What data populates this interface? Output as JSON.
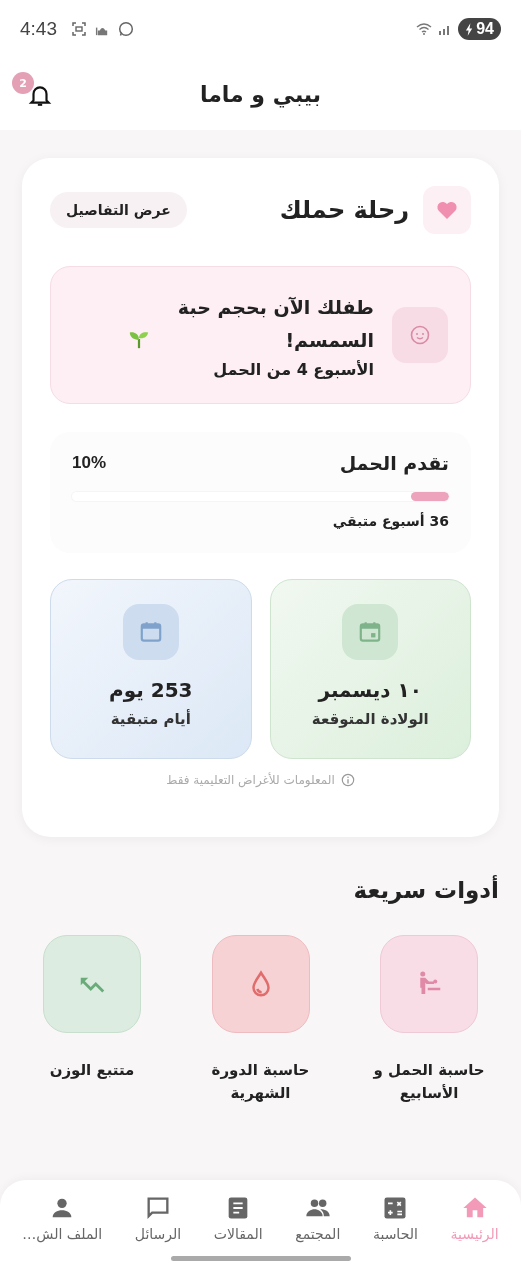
{
  "status_bar": {
    "time": "4:43",
    "battery": "94"
  },
  "app_bar": {
    "title": "بيبي و ماما",
    "notification_count": "2"
  },
  "journey": {
    "title": "رحلة حملك",
    "details_button": "عرض التفاصيل",
    "baby_size": {
      "title": "طفلك الآن بحجم حبة السمسم!",
      "week": "الأسبوع 4 من الحمل"
    },
    "progress": {
      "title": "تقدم الحمل",
      "percent": "10%",
      "level": 0.1,
      "remaining": "36 أسبوع متبقي"
    },
    "stats": [
      {
        "kind": "due",
        "value": "١٠ ديسمبر",
        "label": "الولادة المتوقعة"
      },
      {
        "kind": "countdown",
        "value": "253 يوم",
        "label": "أيام متبقية"
      }
    ],
    "disclaimer": "المعلومات للأغراض التعليمية فقط"
  },
  "quick_tools": {
    "title": "أدوات سريعة",
    "items": [
      {
        "kind": "pregnancy",
        "label": "حاسبة الحمل و الأسابيع"
      },
      {
        "kind": "period",
        "label": "حاسبة الدورة الشهرية"
      },
      {
        "kind": "weight",
        "label": "متتبع الوزن"
      }
    ]
  },
  "bottom_nav": [
    {
      "kind": "home",
      "label": "الرئيسية",
      "selected": true
    },
    {
      "kind": "calculator",
      "label": "الحاسبة",
      "selected": false
    },
    {
      "kind": "community",
      "label": "المجتمع",
      "selected": false
    },
    {
      "kind": "articles",
      "label": "المقالات",
      "selected": false
    },
    {
      "kind": "messages",
      "label": "الرسائل",
      "selected": false
    },
    {
      "kind": "profile",
      "label": "الملف الش…",
      "selected": false
    }
  ]
}
